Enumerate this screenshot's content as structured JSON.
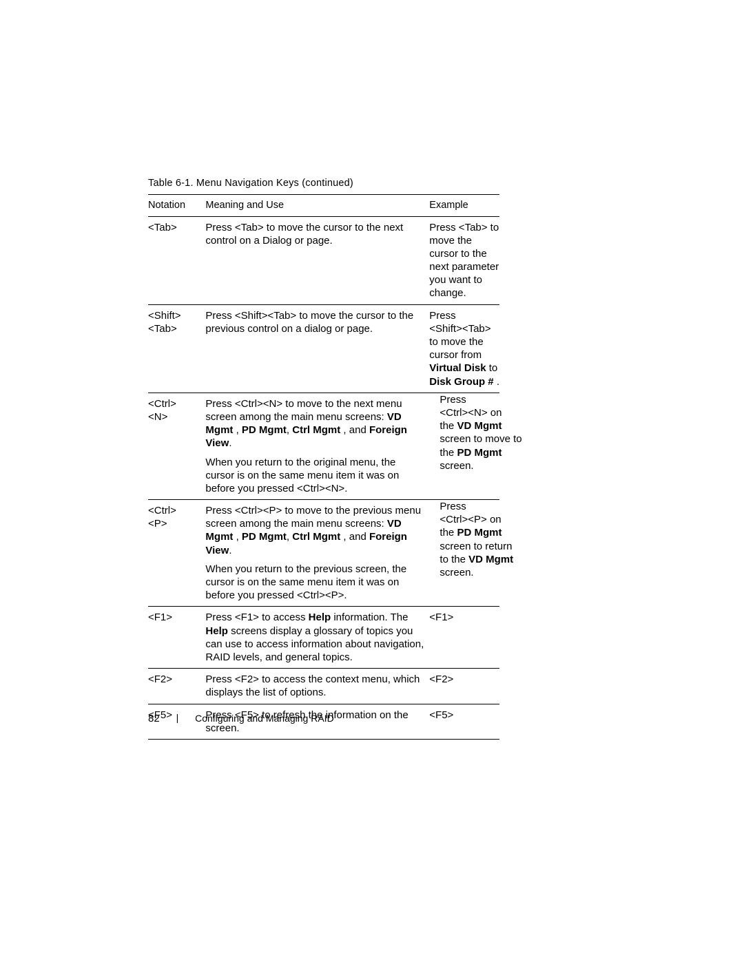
{
  "caption": "Table 6-1.    Menu Navigation Keys (continued)",
  "headers": {
    "notation": "Notation",
    "meaning": "Meaning and Use",
    "example": "Example"
  },
  "rows": {
    "tab": {
      "notation": "<Tab>",
      "meaning": "Press <Tab> to move the cursor to the next control on a Dialog or page.",
      "example": "Press <Tab> to move the cursor to the next parameter you want to change."
    },
    "shifttab": {
      "notation_l1": "<Shift>",
      "notation_l2": "<Tab>",
      "meaning": "Press <Shift><Tab> to move the cursor to the previous control on a dialog or page.",
      "example_word_press": "Press",
      "example_l2": "<Shift><Tab> to move the",
      "example_l3": "cursor from",
      "example_bold1": "Virtual Disk",
      "example_after1": " to",
      "example_bold2": "Disk Group #",
      "example_after2": " ."
    },
    "ctrln": {
      "notation_l1": "<Ctrl>",
      "notation_l2": "<N>",
      "meaning_p1_a": "Press <Ctrl><N> to move to the next menu screen among the main menu screens: ",
      "meaning_p1_b1": "VD Mgmt",
      "meaning_p1_c1": " , ",
      "meaning_p1_b2": "PD Mgmt",
      "meaning_p1_c2": ", ",
      "meaning_p1_b3": "Ctrl Mgmt",
      "meaning_p1_c3": " , and ",
      "meaning_p1_b4": "Foreign View",
      "meaning_p1_end": ".",
      "meaning_p2": "When you return to the original menu, the cursor is on the same menu item it was on before you pressed <Ctrl><N>.",
      "example_l1": "Press",
      "example_l2": "<Ctrl><N> on",
      "example_l3a": "the ",
      "example_l3b": "VD Mgmt",
      "example_l4": "screen to move to",
      "example_l5a": "the ",
      "example_l5b": "PD Mgmt",
      "example_l6": "screen."
    },
    "ctrlp": {
      "notation_l1": "<Ctrl>",
      "notation_l2": "<P>",
      "meaning_p1_a": "Press <Ctrl><P> to move to the previous menu screen among the main menu screens: ",
      "meaning_p1_b1": "VD Mgmt",
      "meaning_p1_c1": " , ",
      "meaning_p1_b2": "PD Mgmt",
      "meaning_p1_c2": ", ",
      "meaning_p1_b3": "Ctrl Mgmt",
      "meaning_p1_c3": " , and ",
      "meaning_p1_b4": "Foreign View",
      "meaning_p1_end": ".",
      "meaning_p2": "When you return to the previous screen, the cursor is on the same menu item it was on before you pressed <Ctrl><P>.",
      "example_l1": "Press",
      "example_l2": "<Ctrl><P> on",
      "example_l3a": "the ",
      "example_l3b": "PD Mgmt",
      "example_l4": "screen to return",
      "example_l5a": "to the ",
      "example_l5b": "VD Mgmt",
      "example_l6": "screen."
    },
    "f1": {
      "notation": "<F1>",
      "meaning_a": "Press <F1> to access ",
      "meaning_b": "Help",
      "meaning_c": " information. The ",
      "meaning_d": "Help",
      "meaning_e": " screens display a glossary of topics you can use to access information about navigation, RAID levels, and general topics.",
      "example": "<F1>"
    },
    "f2": {
      "notation": "<F2>",
      "meaning": "Press <F2> to access the context menu, which displays the list of options.",
      "example": "<F2>"
    },
    "f5": {
      "notation": "<F5>",
      "meaning": "Press <F5> to refresh the information on the screen.",
      "example": "<F5>"
    }
  },
  "footer": {
    "page": "82",
    "sep": "|",
    "title": "Configuring and Managing RAID"
  }
}
